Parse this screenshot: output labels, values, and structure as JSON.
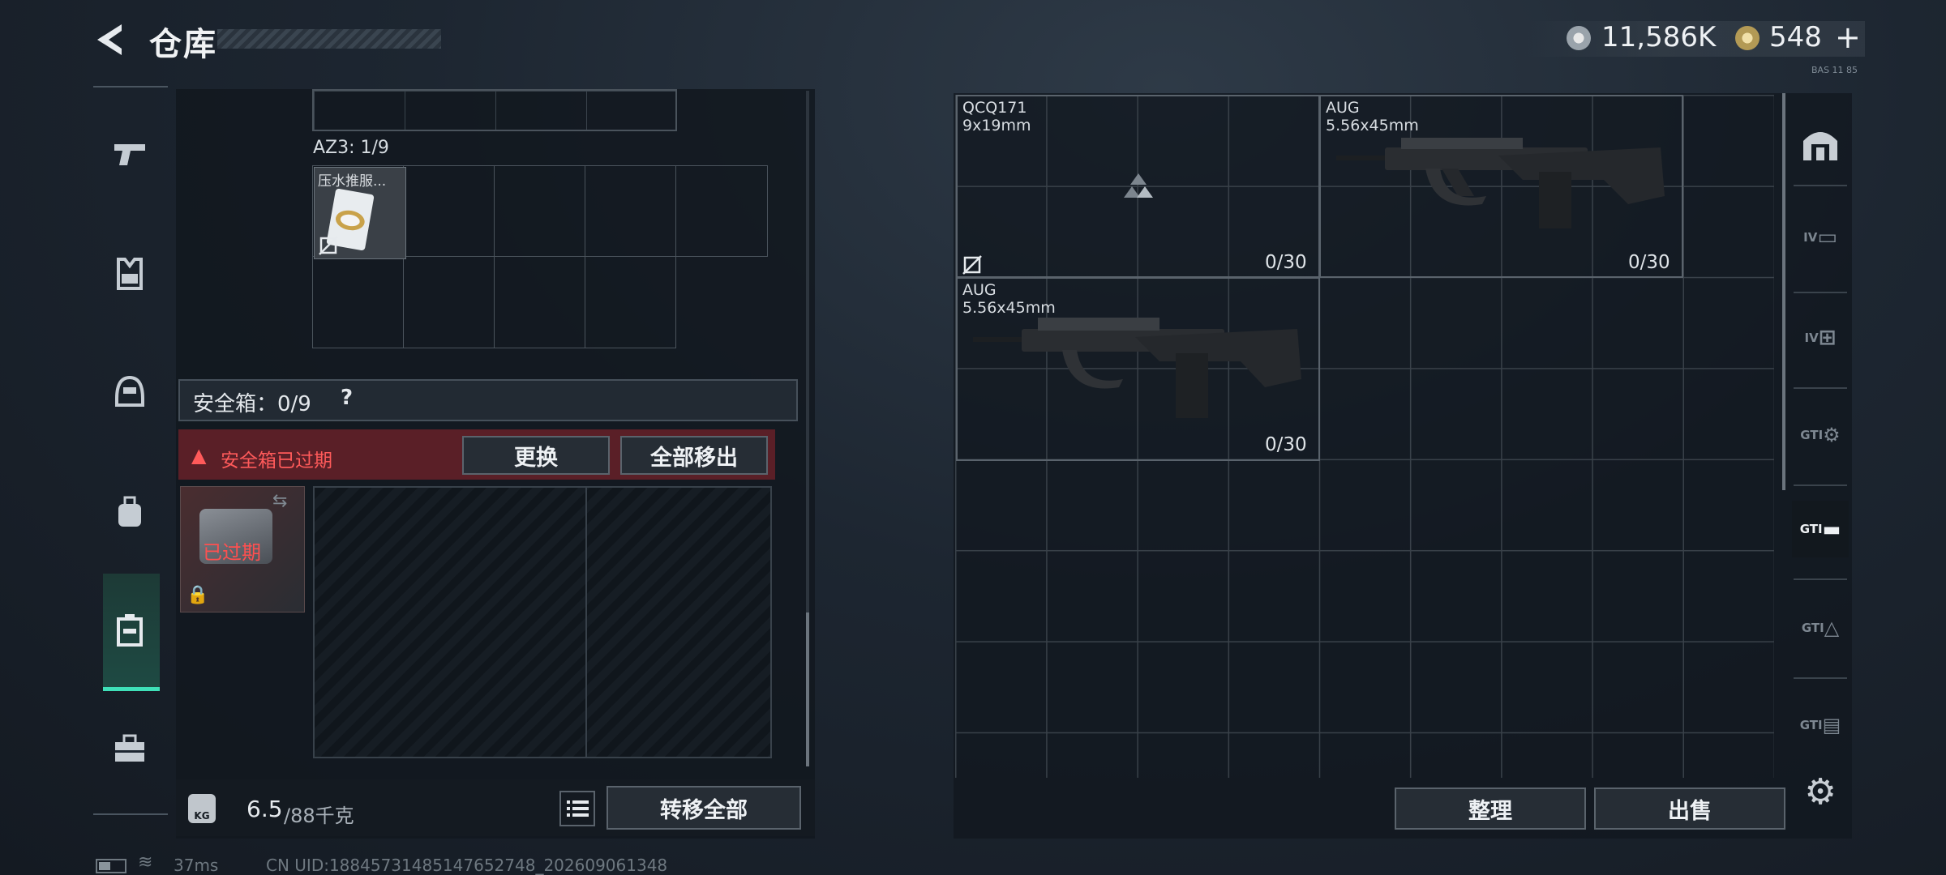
{
  "header": {
    "title": "仓库",
    "currency_silver": "11,586K",
    "currency_gold": "548",
    "gold_plus": "+",
    "version": "BAS 11 85"
  },
  "left_nav": {
    "items": [
      "pistol-icon",
      "vest-icon",
      "helmet-icon",
      "backpack-icon",
      "safe-box-icon",
      "toolbox-icon"
    ],
    "active_index": 4
  },
  "inventory": {
    "az3_label": "AZ3: 1/9",
    "az3_item_label": "压水推服...",
    "safe_label": "安全箱：0/9",
    "safe_help": "?",
    "expired_warning": "安全箱已过期",
    "replace_button": "更换",
    "move_all_button": "全部移出",
    "safe_item_overlay": "已过期",
    "weight_current": "6.5",
    "weight_max": "/88千克",
    "kg_label": "KG",
    "transfer_all_button": "转移全部"
  },
  "status": {
    "ping": "37ms",
    "uid": "CN UID:18845731485147652748_202609061348"
  },
  "storage": {
    "weapons": [
      {
        "name": "QCQ171",
        "caliber": "9x19mm",
        "ammo": "0/30"
      },
      {
        "name": "AUG",
        "caliber": "5.56x45mm",
        "ammo": "0/30"
      },
      {
        "name": "AUG",
        "caliber": "5.56x45mm",
        "ammo": "0/30"
      }
    ],
    "sort_button": "整理",
    "sell_button": "出售"
  },
  "right_nav": {
    "items": [
      "armory-icon",
      "IV",
      "IV",
      "GTI",
      "GTI",
      "GTI",
      "GTI"
    ],
    "active_index": 4
  },
  "colors": {
    "accent": "#3fe0b8",
    "warning": "#ff5a5a",
    "warning_bg": "#5a1f27"
  }
}
